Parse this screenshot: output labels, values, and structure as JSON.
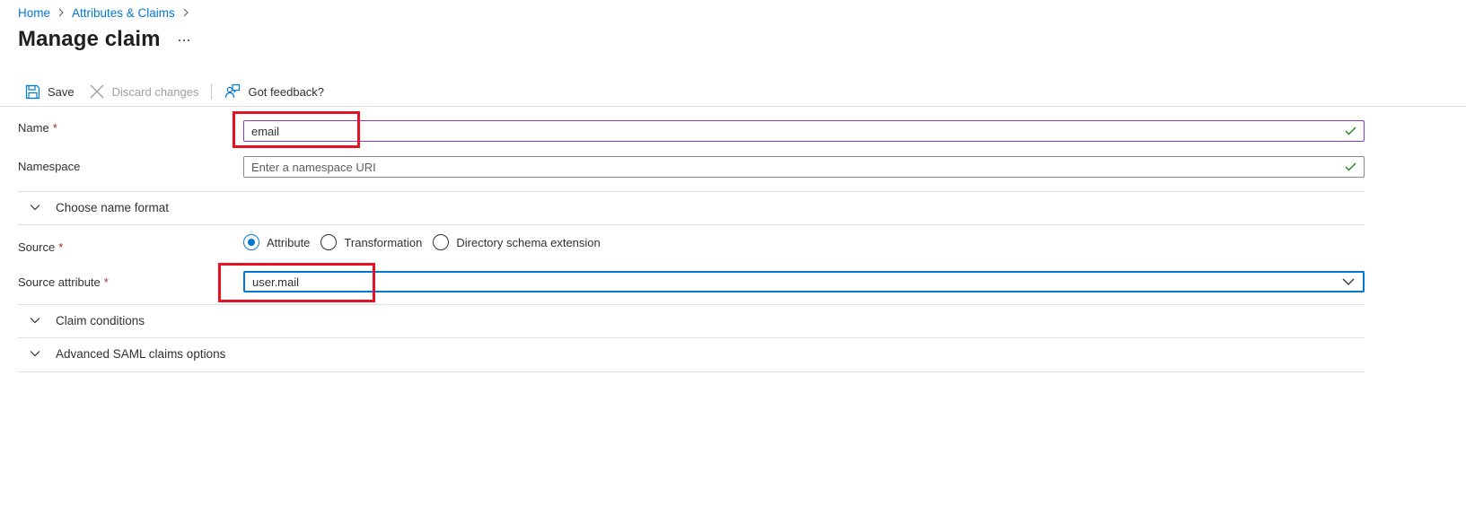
{
  "breadcrumb": {
    "items": [
      {
        "label": "Home"
      },
      {
        "label": "Attributes & Claims"
      }
    ]
  },
  "page": {
    "title": "Manage claim",
    "more_label": "···"
  },
  "toolbar": {
    "save_label": "Save",
    "discard_label": "Discard changes",
    "feedback_label": "Got feedback?"
  },
  "form": {
    "name": {
      "label": "Name",
      "required_mark": "*",
      "value": "email",
      "valid": true
    },
    "namespace": {
      "label": "Namespace",
      "placeholder": "Enter a namespace URI",
      "value": "",
      "valid": true
    },
    "name_format": {
      "label": "Choose name format",
      "expanded": false
    },
    "source": {
      "label": "Source",
      "required_mark": "*",
      "options": [
        {
          "label": "Attribute",
          "checked": true
        },
        {
          "label": "Transformation",
          "checked": false
        },
        {
          "label": "Directory schema extension",
          "checked": false
        }
      ]
    },
    "source_attribute": {
      "label": "Source attribute",
      "required_mark": "*",
      "value": "user.mail"
    },
    "claim_conditions": {
      "label": "Claim conditions",
      "expanded": false
    },
    "advanced_saml": {
      "label": "Advanced SAML claims options",
      "expanded": false
    }
  },
  "colors": {
    "accent": "#0078d4",
    "focused_border": "#8a3ab9",
    "valid_check": "#107c10",
    "required": "#a4262c",
    "annotation": "#e81123"
  },
  "icons": {
    "save": "save-icon",
    "discard": "close-icon",
    "feedback": "feedback-icon",
    "valid": "checkmark-icon",
    "expand": "chevron-down-icon",
    "dropdown": "chevron-down-icon"
  }
}
